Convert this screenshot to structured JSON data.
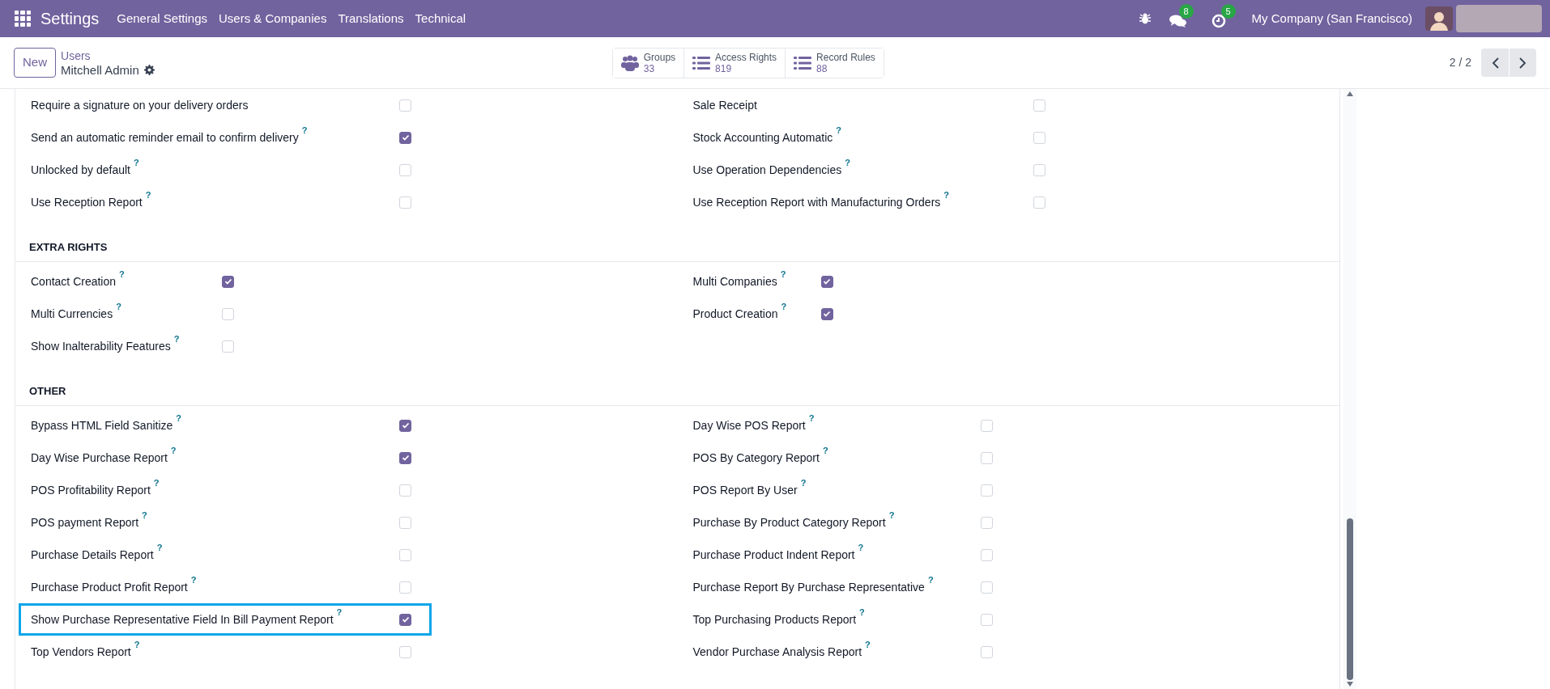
{
  "navbar": {
    "app_title": "Settings",
    "menu": [
      "General Settings",
      "Users & Companies",
      "Translations",
      "Technical"
    ],
    "messages_badge": "8",
    "activities_badge": "5",
    "company": "My Company (San Francisco)"
  },
  "control_panel": {
    "new_button": "New",
    "breadcrumb_parent": "Users",
    "breadcrumb_current": "Mitchell Admin",
    "stat_buttons": [
      {
        "kind": "groups",
        "label": "Groups",
        "value": "33"
      },
      {
        "kind": "list",
        "label": "Access Rights",
        "value": "819"
      },
      {
        "kind": "list",
        "label": "Record Rules",
        "value": "88"
      }
    ],
    "pager": "2 / 2"
  },
  "sections": [
    {
      "left_column": [
        {
          "label": "Require a signature on your delivery orders",
          "checked": false,
          "highlighted": false
        },
        {
          "label": "Send an automatic reminder email to confirm delivery",
          "help": "?",
          "checked": true,
          "highlighted": false
        },
        {
          "label": "Unlocked by default",
          "help": "?",
          "checked": false,
          "highlighted": false
        },
        {
          "label": "Use Reception Report",
          "help": "?",
          "checked": false,
          "highlighted": false
        }
      ],
      "right_column": [
        {
          "label": "Sale Receipt",
          "checked": false,
          "highlighted": false
        },
        {
          "label": "Stock Accounting Automatic",
          "help": "?",
          "checked": false,
          "highlighted": false
        },
        {
          "label": "Use Operation Dependencies",
          "help": "?",
          "checked": false,
          "highlighted": false
        },
        {
          "label": "Use Reception Report with Manufacturing Orders",
          "help": "?",
          "checked": false,
          "highlighted": false
        }
      ]
    },
    {
      "heading": "EXTRA RIGHTS",
      "left_column": [
        {
          "label": "Contact Creation",
          "help": "?",
          "checked": true,
          "highlighted": false
        },
        {
          "label": "Multi Currencies",
          "help": "?",
          "checked": false,
          "highlighted": false
        },
        {
          "label": "Show Inalterability Features",
          "help": "?",
          "checked": false,
          "highlighted": false
        }
      ],
      "right_column": [
        {
          "label": "Multi Companies",
          "help": "?",
          "checked": true,
          "highlighted": false
        },
        {
          "label": "Product Creation",
          "help": "?",
          "checked": true,
          "highlighted": false
        }
      ]
    },
    {
      "heading": "OTHER",
      "left_column": [
        {
          "label": "Bypass HTML Field Sanitize",
          "help": "?",
          "checked": true,
          "highlighted": false
        },
        {
          "label": "Day Wise Purchase Report",
          "help": "?",
          "checked": true,
          "highlighted": false
        },
        {
          "label": "POS Profitability Report",
          "help": "?",
          "checked": false,
          "highlighted": false
        },
        {
          "label": "POS payment Report",
          "help": "?",
          "checked": false,
          "highlighted": false
        },
        {
          "label": "Purchase Details Report",
          "help": "?",
          "checked": false,
          "highlighted": false
        },
        {
          "label": "Purchase Product Profit Report",
          "help": "?",
          "checked": false,
          "highlighted": false
        },
        {
          "label": "Show Purchase Representative Field In Bill Payment Report",
          "help": "?",
          "checked": true,
          "highlighted": true
        },
        {
          "label": "Top Vendors Report",
          "help": "?",
          "checked": false,
          "highlighted": false
        }
      ],
      "right_column": [
        {
          "label": "Day Wise POS Report",
          "help": "?",
          "checked": false,
          "highlighted": false
        },
        {
          "label": "POS By Category Report",
          "help": "?",
          "checked": false,
          "highlighted": false
        },
        {
          "label": "POS Report By User",
          "help": "?",
          "checked": false,
          "highlighted": false
        },
        {
          "label": "Purchase By Product Category Report",
          "help": "?",
          "checked": false,
          "highlighted": false
        },
        {
          "label": "Purchase Product Indent Report",
          "help": "?",
          "checked": false,
          "highlighted": false
        },
        {
          "label": "Purchase Report By Purchase Representative",
          "help": "?",
          "checked": false,
          "highlighted": false
        },
        {
          "label": "Top Purchasing Products Report",
          "help": "?",
          "checked": false,
          "highlighted": false
        },
        {
          "label": "Vendor Purchase Analysis Report",
          "help": "?",
          "checked": false,
          "highlighted": false
        }
      ]
    }
  ]
}
